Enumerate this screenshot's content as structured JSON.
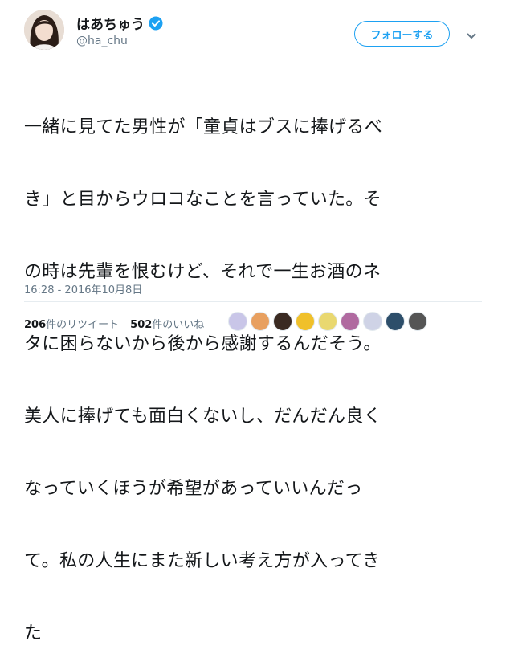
{
  "user": {
    "name": "はあちゅう",
    "handle": "@ha_chu"
  },
  "follow_label": "フォローする",
  "tweet_lines": [
    "一緒に見てた男性が「童貞はブスに捧げるべ",
    "き」と目からウロコなことを言っていた。そ",
    "の時は先輩を恨むけど、それで一生お酒のネ",
    "タに困らないから後から感謝するんだそう。",
    "美人に捧げても面白くないし、だんだん良く",
    "なっていくほうが希望があっていいんだっ",
    "て。私の人生にまた新しい考え方が入ってき",
    "た"
  ],
  "timestamp": "16:28 - 2016年10月8日",
  "stats": {
    "retweet_count": "206",
    "retweet_label": "件のリツイート",
    "like_count": "502",
    "like_label": "件のいいね"
  },
  "colors": {
    "accent": "#1da1f2",
    "text": "#14171a",
    "secondary": "#657786"
  },
  "liker_avatars": [
    {
      "color": "#c9c6e8"
    },
    {
      "color": "#e8a060"
    },
    {
      "color": "#3a2a22"
    },
    {
      "color": "#f0c02a"
    },
    {
      "color": "#e9d870"
    },
    {
      "color": "#b06aa0"
    },
    {
      "color": "#cfd3e6"
    },
    {
      "color": "#2d4e6a"
    },
    {
      "color": "#555555"
    }
  ]
}
